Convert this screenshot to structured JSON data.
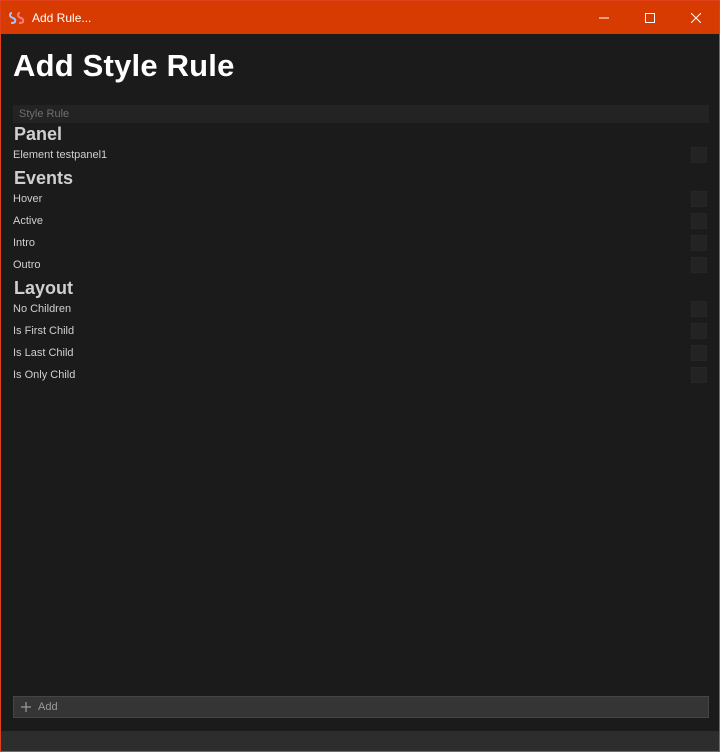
{
  "window": {
    "title": "Add Rule...",
    "accent_color": "#d83b01"
  },
  "page": {
    "title": "Add Style Rule",
    "search_placeholder": "Style Rule"
  },
  "sections": {
    "panel": {
      "heading": "Panel",
      "items": [
        "Element testpanel1"
      ]
    },
    "events": {
      "heading": "Events",
      "items": [
        "Hover",
        "Active",
        "Intro",
        "Outro"
      ]
    },
    "layout": {
      "heading": "Layout",
      "items": [
        "No Children",
        "Is First Child",
        "Is Last Child",
        "Is Only Child"
      ]
    }
  },
  "footer": {
    "add_label": "Add"
  }
}
